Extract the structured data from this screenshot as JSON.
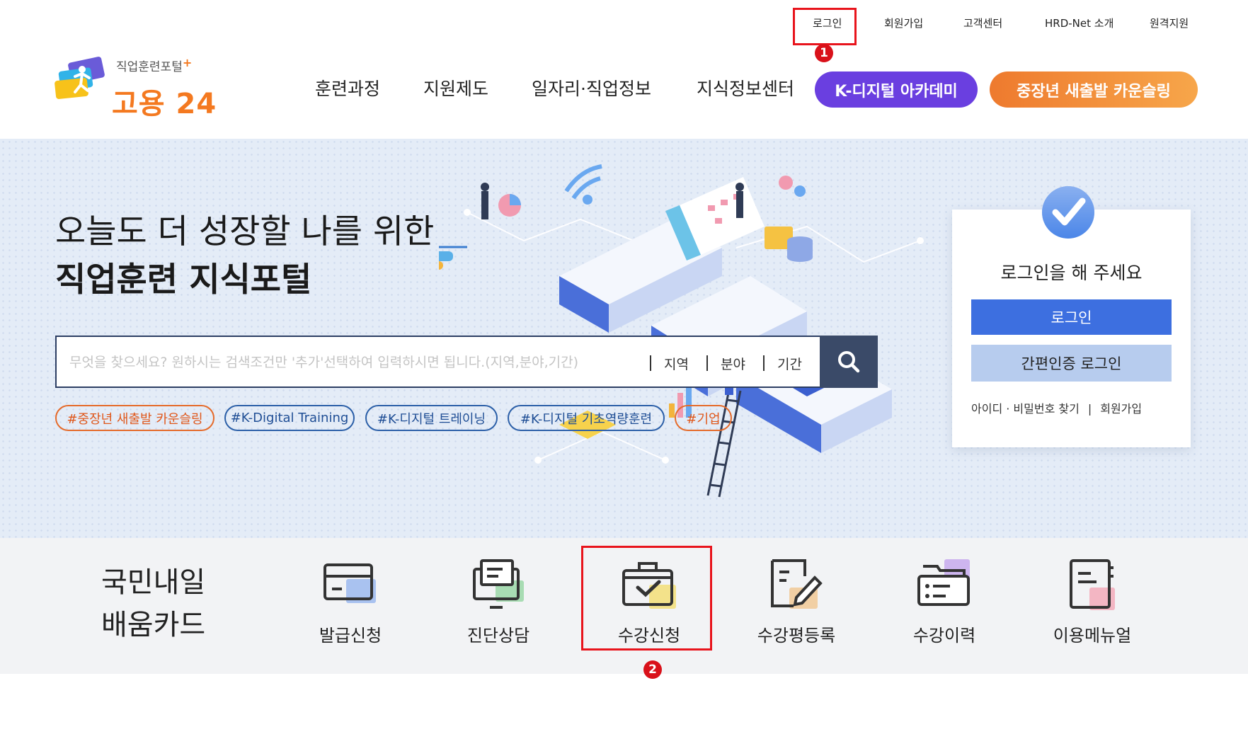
{
  "top_links": {
    "login": "로그인",
    "signup": "회원가입",
    "support": "고객센터",
    "about": "HRD-Net 소개",
    "remote": "원격지원"
  },
  "annotations": {
    "first": "1",
    "second": "2",
    "color": "#e8141c"
  },
  "logo": {
    "subtitle": "직업훈련포털",
    "plus": "+",
    "name": "고용 24"
  },
  "nav": {
    "items": [
      "훈련과정",
      "지원제도",
      "일자리·직업정보",
      "지식정보센터"
    ],
    "k_digital": "K-디지털 아카데미",
    "middle_age": "중장년 새출발 카운슬링"
  },
  "hero": {
    "line1": "오늘도 더 성장할 나를 위한",
    "line2": "직업훈련 지식포털",
    "search": {
      "placeholder": "무엇을 찾으세요? 원하시는 검색조건만 '추가'선택하여 입력하시면 됩니다.(지역,분야,기간)",
      "value": "",
      "filters": [
        "지역",
        "분야",
        "기간"
      ]
    },
    "tags": [
      "#중장년 새출발 카운슬링",
      "#K-Digital Training",
      "#K-디지털 트레이닝",
      "#K-디지털 기초역량훈련",
      "#기업"
    ]
  },
  "login_card": {
    "message": "로그인을 해 주세요",
    "login_button": "로그인",
    "simple_login_button": "간편인증 로그인",
    "find_link": "아이디 · 비밀번호 찾기",
    "separator": "|",
    "signup_link": "회원가입"
  },
  "card_services": {
    "title_line1": "국민내일",
    "title_line2": "배움카드",
    "items": [
      {
        "label": "발급신청",
        "icon": "card-icon"
      },
      {
        "label": "진단상담",
        "icon": "monitor-chat-icon"
      },
      {
        "label": "수강신청",
        "icon": "briefcase-check-icon"
      },
      {
        "label": "수강평등록",
        "icon": "document-pen-icon"
      },
      {
        "label": "수강이력",
        "icon": "folder-history-icon"
      },
      {
        "label": "이용메뉴얼",
        "icon": "manual-book-icon"
      }
    ]
  },
  "colors": {
    "brand_orange": "#f47920",
    "k_digital_purple": "#6a3fe0",
    "middle_age_orange": "#f08a3a",
    "login_blue": "#3d6fe0",
    "search_navy": "#3a4a68"
  }
}
